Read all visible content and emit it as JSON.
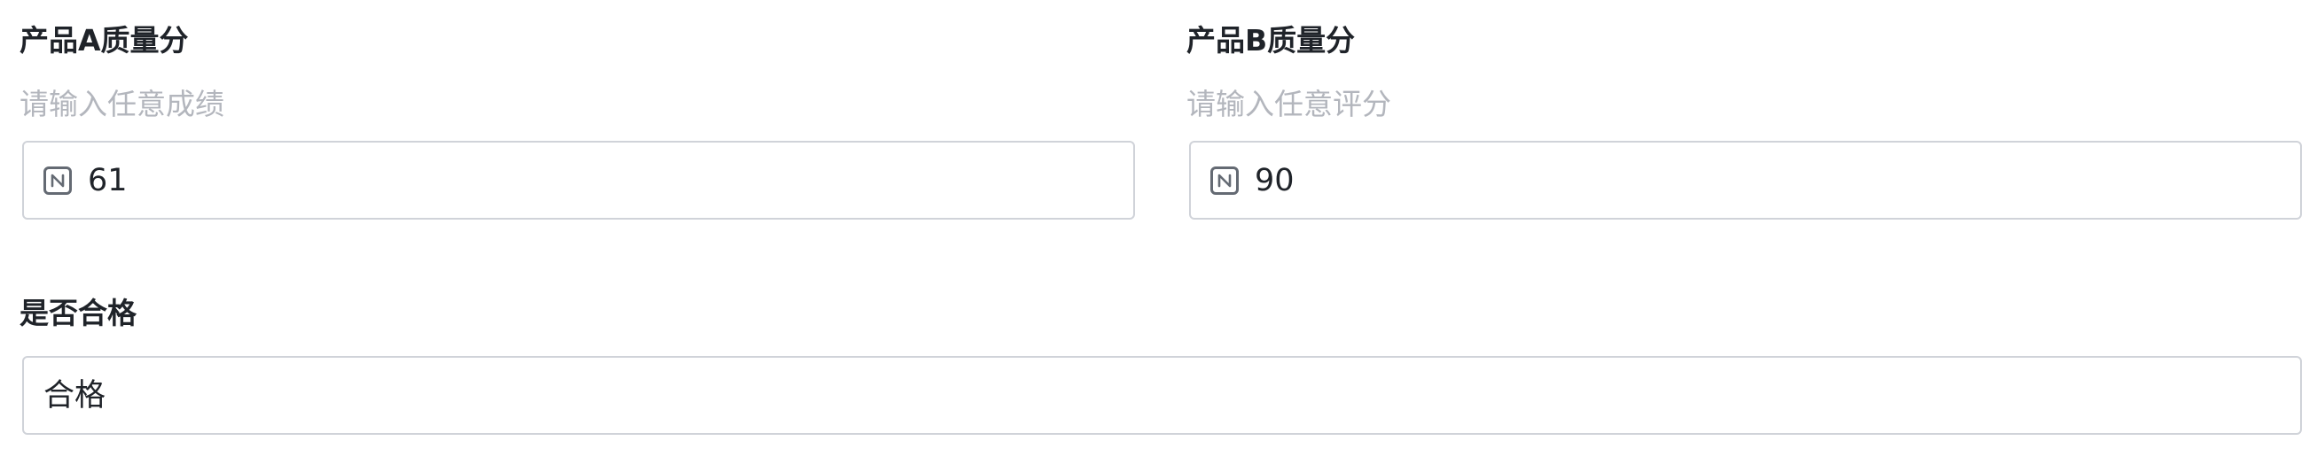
{
  "fields": {
    "product_a": {
      "label": "产品A质量分",
      "placeholder": "请输入任意成绩",
      "value": "61",
      "icon": "number-field-icon"
    },
    "product_b": {
      "label": "产品B质量分",
      "placeholder": "请输入任意评分",
      "value": "90",
      "icon": "number-field-icon"
    },
    "qualified": {
      "label": "是否合格",
      "value": "合格"
    }
  },
  "colors": {
    "label_text": "#1f2329",
    "placeholder_text": "#b3b6bd",
    "input_border": "#d0d3d9",
    "icon": "#646a73"
  }
}
